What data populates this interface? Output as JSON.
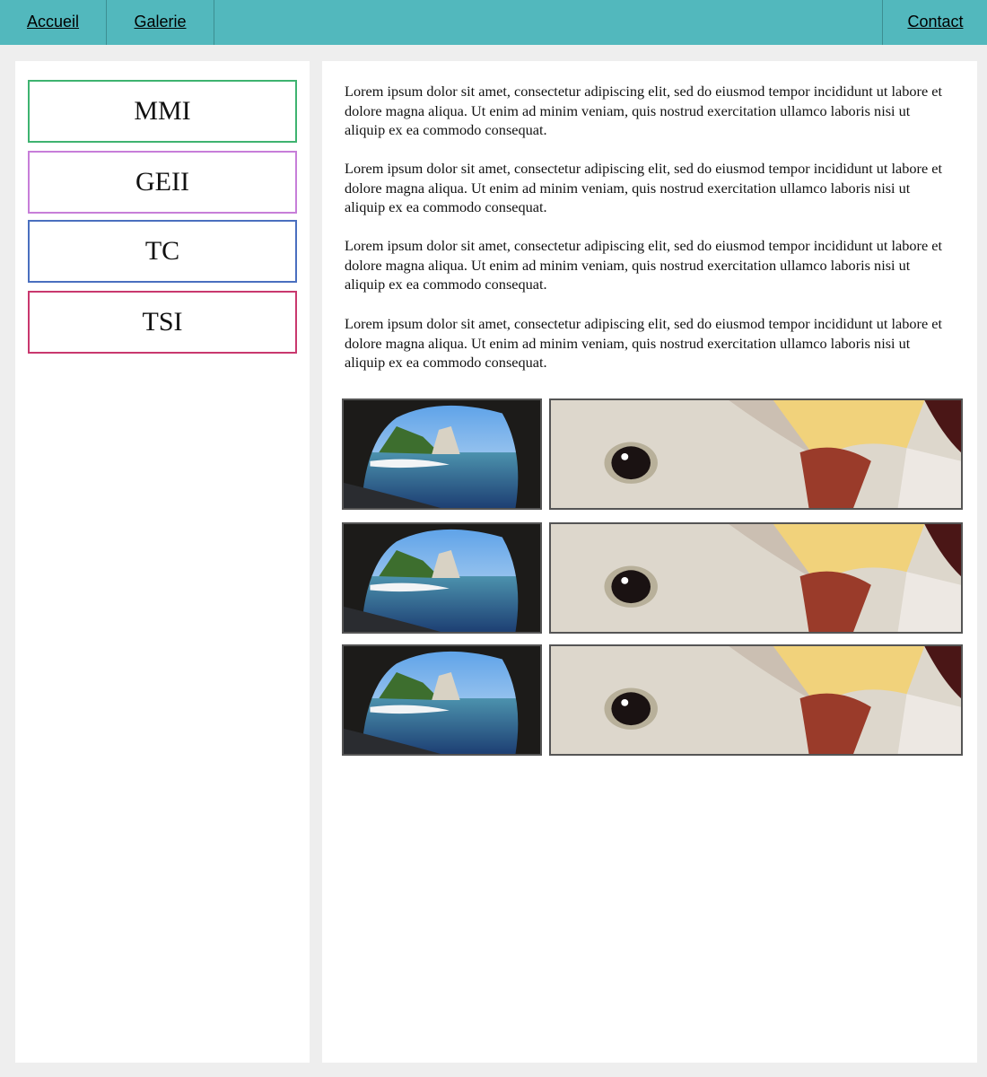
{
  "nav": {
    "links_left": [
      "Accueil",
      "Galerie"
    ],
    "link_right": "Contact",
    "color": "#52b8bd"
  },
  "sidebar": {
    "items": [
      {
        "label": "MMI",
        "border_color": "#3eb370"
      },
      {
        "label": "GEII",
        "border_color": "#c77ed9"
      },
      {
        "label": "TC",
        "border_color": "#4a6fbf"
      },
      {
        "label": "TSI",
        "border_color": "#c9386e"
      }
    ]
  },
  "main": {
    "paragraphs": [
      "Lorem ipsum dolor sit amet, consectetur adipiscing elit, sed do eiusmod tempor incididunt ut labore et dolore magna aliqua. Ut enim ad minim veniam, quis nostrud exercitation ullamco laboris nisi ut aliquip ex ea commodo consequat.",
      "Lorem ipsum dolor sit amet, consectetur adipiscing elit, sed do eiusmod tempor incididunt ut labore et dolore magna aliqua. Ut enim ad minim veniam, quis nostrud exercitation ullamco laboris nisi ut aliquip ex ea commodo consequat.",
      "Lorem ipsum dolor sit amet, consectetur adipiscing elit, sed do eiusmod tempor incididunt ut labore et dolore magna aliqua. Ut enim ad minim veniam, quis nostrud exercitation ullamco laboris nisi ut aliquip ex ea commodo consequat.",
      "Lorem ipsum dolor sit amet, consectetur adipiscing elit, sed do eiusmod tempor incididunt ut labore et dolore magna aliqua. Ut enim ad minim veniam, quis nostrud exercitation ullamco laboris nisi ut aliquip ex ea commodo consequat."
    ],
    "gallery_rows": [
      {
        "left": "sea-cave-photo",
        "right": "bird-closeup-photo"
      },
      {
        "left": "sea-cave-photo",
        "right": "bird-closeup-photo"
      },
      {
        "left": "sea-cave-photo",
        "right": "bird-closeup-photo"
      }
    ]
  }
}
